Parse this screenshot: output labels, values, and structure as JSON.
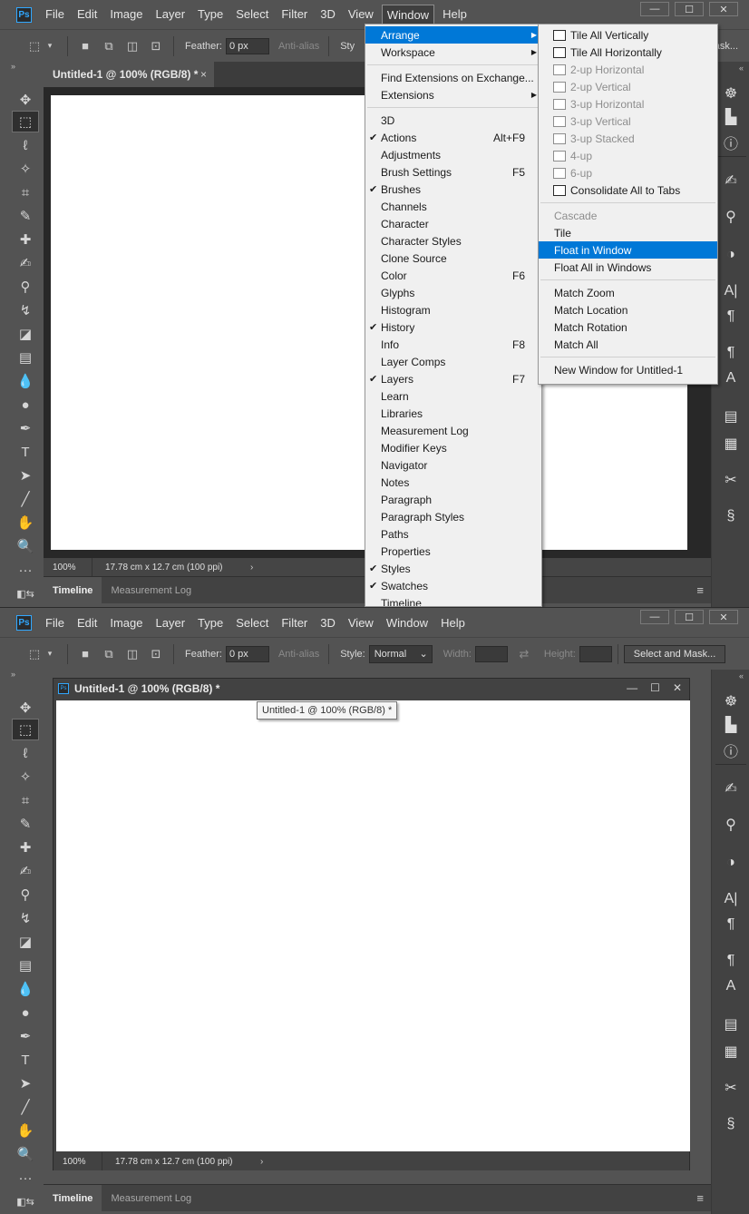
{
  "app": {
    "logo": "Ps",
    "menus": [
      "File",
      "Edit",
      "Image",
      "Layer",
      "Type",
      "Select",
      "Filter",
      "3D",
      "View",
      "Window",
      "Help"
    ],
    "active_menu": "Window",
    "window_controls": [
      "—",
      "☐",
      "✕"
    ]
  },
  "options_bar": {
    "feather_label": "Feather:",
    "feather_value": "0 px",
    "antialias_label": "Anti-alias",
    "style_label": "Style:",
    "style_label_cut": "Sty",
    "style_value": "Normal",
    "width_label": "Width:",
    "height_label": "Height:",
    "select_mask_label": "Select and Mask...",
    "select_mask_cut": "Mask..."
  },
  "document": {
    "tab_title": "Untitled-1 @ 100% (RGB/8) *",
    "tab_close": "×",
    "zoom": "100%",
    "doc_info": "17.78 cm x 12.7 cm (100 ppi)",
    "status_arrow": "›",
    "tooltip": "Untitled-1 @ 100% (RGB/8) *"
  },
  "bottom_panel": {
    "tabs": [
      "Timeline",
      "Measurement Log"
    ],
    "menu_icon": "≡"
  },
  "window_menu": {
    "items": [
      {
        "label": "Arrange",
        "submenu": true,
        "highlight": true
      },
      {
        "label": "Workspace",
        "submenu": true
      },
      {
        "sep": true
      },
      {
        "label": "Find Extensions on Exchange..."
      },
      {
        "label": "Extensions",
        "submenu": true
      },
      {
        "sep": true
      },
      {
        "label": "3D"
      },
      {
        "label": "Actions",
        "checked": true,
        "shortcut": "Alt+F9"
      },
      {
        "label": "Adjustments"
      },
      {
        "label": "Brush Settings",
        "shortcut": "F5"
      },
      {
        "label": "Brushes",
        "checked": true
      },
      {
        "label": "Channels"
      },
      {
        "label": "Character"
      },
      {
        "label": "Character Styles"
      },
      {
        "label": "Clone Source"
      },
      {
        "label": "Color",
        "shortcut": "F6"
      },
      {
        "label": "Glyphs"
      },
      {
        "label": "Histogram"
      },
      {
        "label": "History",
        "checked": true
      },
      {
        "label": "Info",
        "shortcut": "F8"
      },
      {
        "label": "Layer Comps"
      },
      {
        "label": "Layers",
        "checked": true,
        "shortcut": "F7"
      },
      {
        "label": "Learn"
      },
      {
        "label": "Libraries"
      },
      {
        "label": "Measurement Log"
      },
      {
        "label": "Modifier Keys"
      },
      {
        "label": "Navigator"
      },
      {
        "label": "Notes"
      },
      {
        "label": "Paragraph"
      },
      {
        "label": "Paragraph Styles"
      },
      {
        "label": "Paths"
      },
      {
        "label": "Properties"
      },
      {
        "label": "Styles",
        "checked": true
      },
      {
        "label": "Swatches",
        "checked": true
      },
      {
        "label": "Timeline"
      }
    ]
  },
  "arrange_menu": {
    "items": [
      {
        "label": "Tile All Vertically",
        "icon": "tile-vertical-icon"
      },
      {
        "label": "Tile All Horizontally",
        "icon": "tile-horizontal-icon"
      },
      {
        "label": "2-up Horizontal",
        "icon": "two-up-horizontal-icon",
        "disabled": true
      },
      {
        "label": "2-up Vertical",
        "icon": "two-up-vertical-icon",
        "disabled": true
      },
      {
        "label": "3-up Horizontal",
        "icon": "three-up-horizontal-icon",
        "disabled": true
      },
      {
        "label": "3-up Vertical",
        "icon": "three-up-vertical-icon",
        "disabled": true
      },
      {
        "label": "3-up Stacked",
        "icon": "three-up-stacked-icon",
        "disabled": true
      },
      {
        "label": "4-up",
        "icon": "four-up-icon",
        "disabled": true
      },
      {
        "label": "6-up",
        "icon": "six-up-icon",
        "disabled": true
      },
      {
        "label": "Consolidate All to Tabs",
        "icon": "consolidate-tabs-icon"
      },
      {
        "sep": true
      },
      {
        "label": "Cascade",
        "disabled": true
      },
      {
        "label": "Tile"
      },
      {
        "label": "Float in Window",
        "highlight": true
      },
      {
        "label": "Float All in Windows"
      },
      {
        "sep": true
      },
      {
        "label": "Match Zoom"
      },
      {
        "label": "Match Location"
      },
      {
        "label": "Match Rotation"
      },
      {
        "label": "Match All"
      },
      {
        "sep": true
      },
      {
        "label": "New Window for Untitled-1"
      }
    ]
  },
  "colors": {
    "ui_bg": "#535353",
    "menu_bg": "#f0f0f0",
    "highlight": "#0078d7",
    "ps_blue": "#31a8ff"
  }
}
